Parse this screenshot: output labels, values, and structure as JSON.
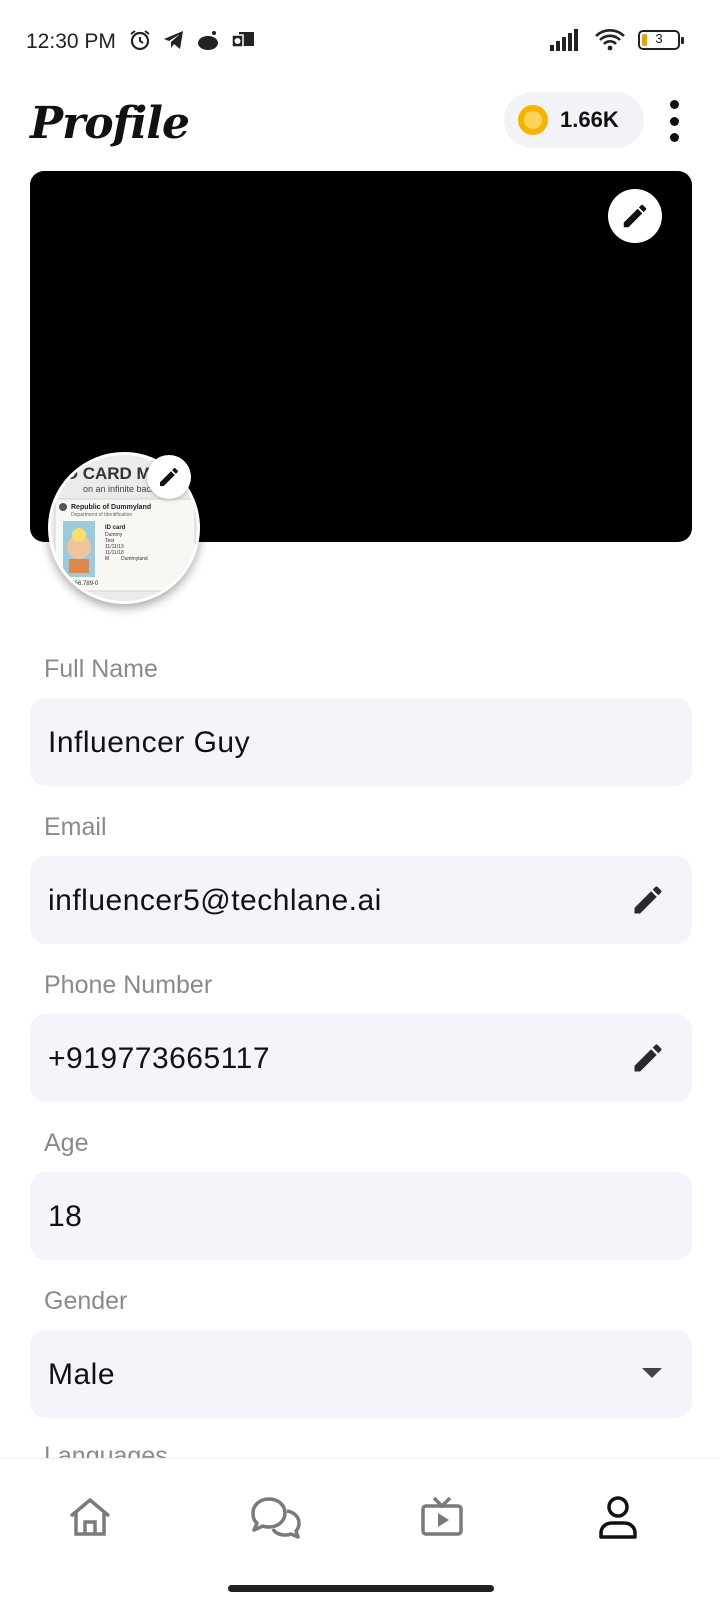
{
  "status_bar": {
    "time": "12:30 PM",
    "battery": "3",
    "icons": [
      "alarm-icon",
      "telegram-icon",
      "reddit-icon",
      "outlook-icon",
      "signal-icon",
      "wifi-icon",
      "battery-icon"
    ]
  },
  "header": {
    "title": "Profile",
    "coins": "1.66K"
  },
  "fields": {
    "full_name": {
      "label": "Full Name",
      "value": "Influencer Guy"
    },
    "email": {
      "label": "Email",
      "value": "influencer5@techlane.ai"
    },
    "phone": {
      "label": "Phone Number",
      "value": "+919773665117"
    },
    "age": {
      "label": "Age",
      "value": "18"
    },
    "gender": {
      "label": "Gender",
      "value": "Male"
    },
    "languages": {
      "label": "Languages"
    }
  },
  "avatar": {
    "card_title": "ID CARD MOC",
    "card_sub": "on an infinite backgr",
    "country": "Republic of Dummyland",
    "dept": "Department of Identification",
    "card_type": "ID card",
    "name1": "Dummy",
    "name2": "Test",
    "date1": "11/11/13",
    "date2": "11/11/18",
    "gender": "M",
    "place": "Dummyland",
    "number": "23.456.789-0"
  },
  "bottom_nav": {
    "items": [
      "home-icon",
      "chat-icon",
      "video-icon",
      "profile-icon"
    ],
    "active": "profile-icon"
  },
  "colors": {
    "field_bg": "#f3f5fa",
    "label": "#8a8a8a",
    "coin": "#f6b400",
    "cover": "#000000"
  }
}
